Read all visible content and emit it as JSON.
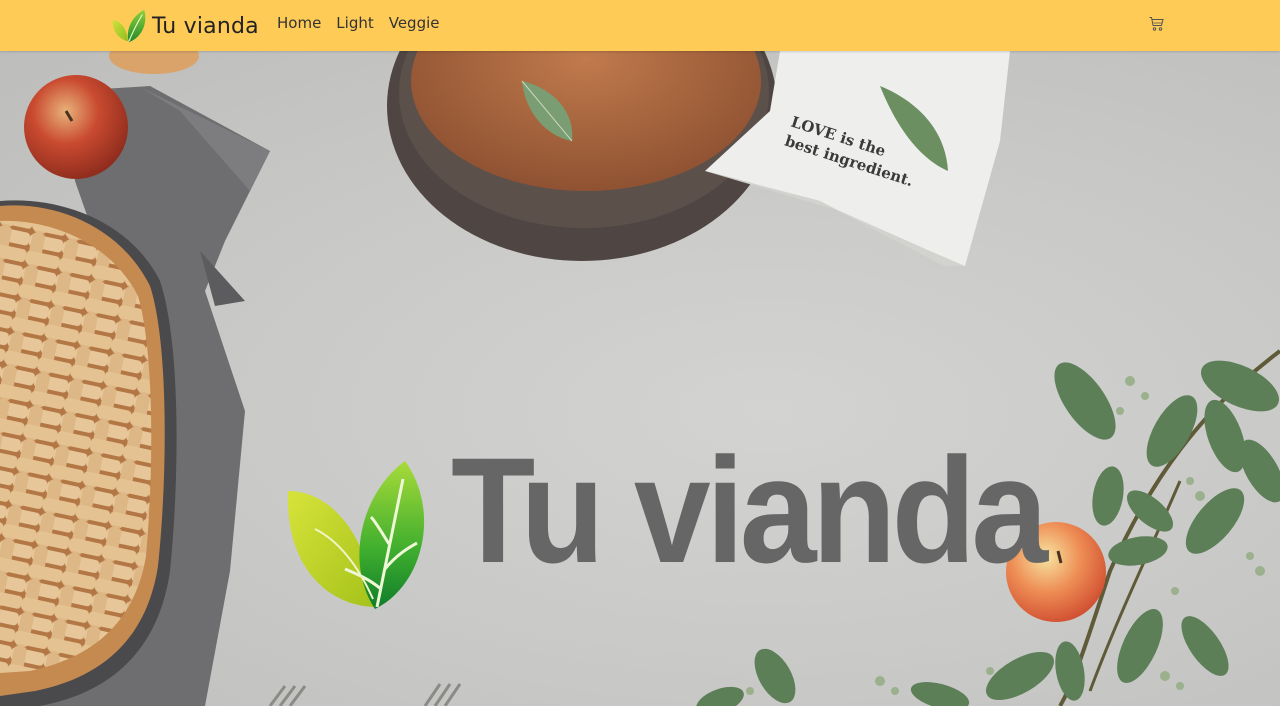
{
  "navbar": {
    "brand_text": "Tu vianda",
    "links": [
      {
        "label": "Home"
      },
      {
        "label": "Light"
      },
      {
        "label": "Veggie"
      }
    ],
    "cart_icon": "cart-icon",
    "background_color": "#ffcb57"
  },
  "hero": {
    "title": "Tu vianda",
    "title_color": "#666666",
    "napkin_text_line1": "LOVE is the",
    "napkin_text_line2": "best ingredient."
  }
}
